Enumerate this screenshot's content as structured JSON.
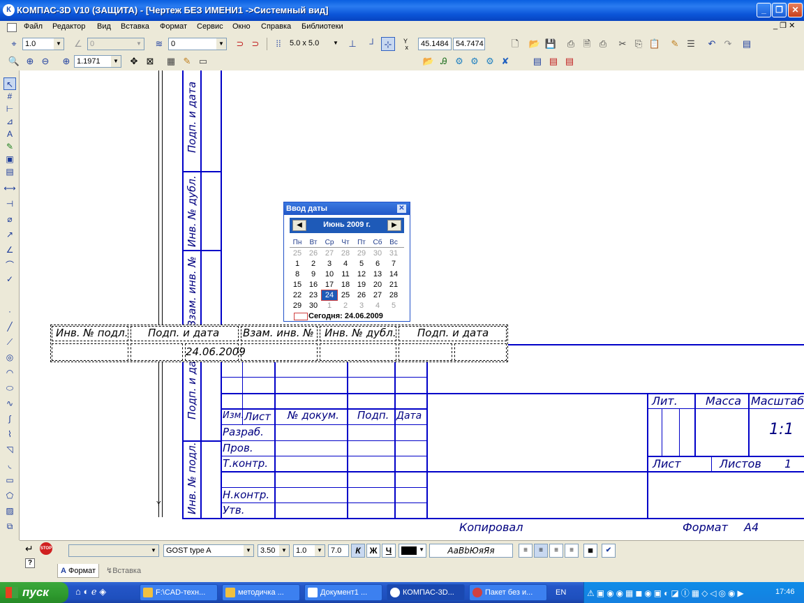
{
  "window": {
    "title": "КОМПАС-3D V10 (ЗАЩИТА) - [Чертеж БЕЗ ИМЕНИ1 ->Системный вид]",
    "app_icon": "К"
  },
  "menu": [
    "Файл",
    "Редактор",
    "Вид",
    "Вставка",
    "Формат",
    "Сервис",
    "Окно",
    "Справка",
    "Библиотеки"
  ],
  "toolbar1": {
    "step": "1.0",
    "angle": "0",
    "layer": "0",
    "grid": "5.0 x 5.0",
    "coord_x": "45.1484",
    "coord_y": "54.7474"
  },
  "toolbar2": {
    "zoom": "1.1971"
  },
  "calendar": {
    "title": "Ввод даты",
    "month": "Июнь 2009 г.",
    "weekdays": [
      "Пн",
      "Вт",
      "Ср",
      "Чт",
      "Пт",
      "Сб",
      "Вс"
    ],
    "weeks": [
      [
        "25",
        "26",
        "27",
        "28",
        "29",
        "30",
        "31"
      ],
      [
        "1",
        "2",
        "3",
        "4",
        "5",
        "6",
        "7"
      ],
      [
        "8",
        "9",
        "10",
        "11",
        "12",
        "13",
        "14"
      ],
      [
        "15",
        "16",
        "17",
        "18",
        "19",
        "20",
        "21"
      ],
      [
        "22",
        "23",
        "24",
        "25",
        "26",
        "27",
        "28"
      ],
      [
        "29",
        "30",
        "1",
        "2",
        "3",
        "4",
        "5"
      ]
    ],
    "selected": "24",
    "today": "Сегодня: 24.06.2009"
  },
  "drawing": {
    "side_labels": [
      "Подп. и дата",
      "Инв. № дубл.",
      "Взам. инв. №",
      "Подп. и дата",
      "Инв. № подл."
    ],
    "float_headers": [
      "Инв. № подл.",
      "Подп. и дата",
      "Взам. инв. №",
      "Инв. № дубл.",
      "Подп. и дата"
    ],
    "float_date": "24.06.2009",
    "stamp": {
      "izm": "Изм.",
      "list": "Лист",
      "doc": "№ докум.",
      "podp": "Подп.",
      "data": "Дата",
      "razrab": "Разраб.",
      "prov": "Пров.",
      "tkontr": "Т.контр.",
      "nkontr": "Н.контр.",
      "utv": "Утв.",
      "lit": "Лит.",
      "massa": "Масса",
      "masshtab": "Масштаб",
      "scale": "1:1",
      "sheet": "Лист",
      "sheets": "Листов",
      "sheets_val": "1",
      "kopiroval": "Копировал",
      "format": "Формат",
      "format_val": "A4"
    },
    "axis_y": "Y"
  },
  "props": {
    "style": "",
    "font": "GOST type A",
    "size": "3.50",
    "stretch": "1.0",
    "spacing": "7.0",
    "sample": "АаВbЮяЯя",
    "bold": "К",
    "italic": "Ж",
    "underline": "Ч",
    "tab_format": "Формат",
    "tab_insert": "Вставка",
    "stop": "STOP"
  },
  "taskbar": {
    "start": "пуск",
    "tasks": [
      "F:\\CAD-техн...",
      "методичка ...",
      "Документ1 ...",
      "КОМПАС-3D...",
      "Пакет без и..."
    ],
    "lang": "EN",
    "time": "17:46"
  },
  "colors": {
    "accent": "#0054e3",
    "drawing": "#0000c8",
    "taskbar": "#245edb"
  }
}
